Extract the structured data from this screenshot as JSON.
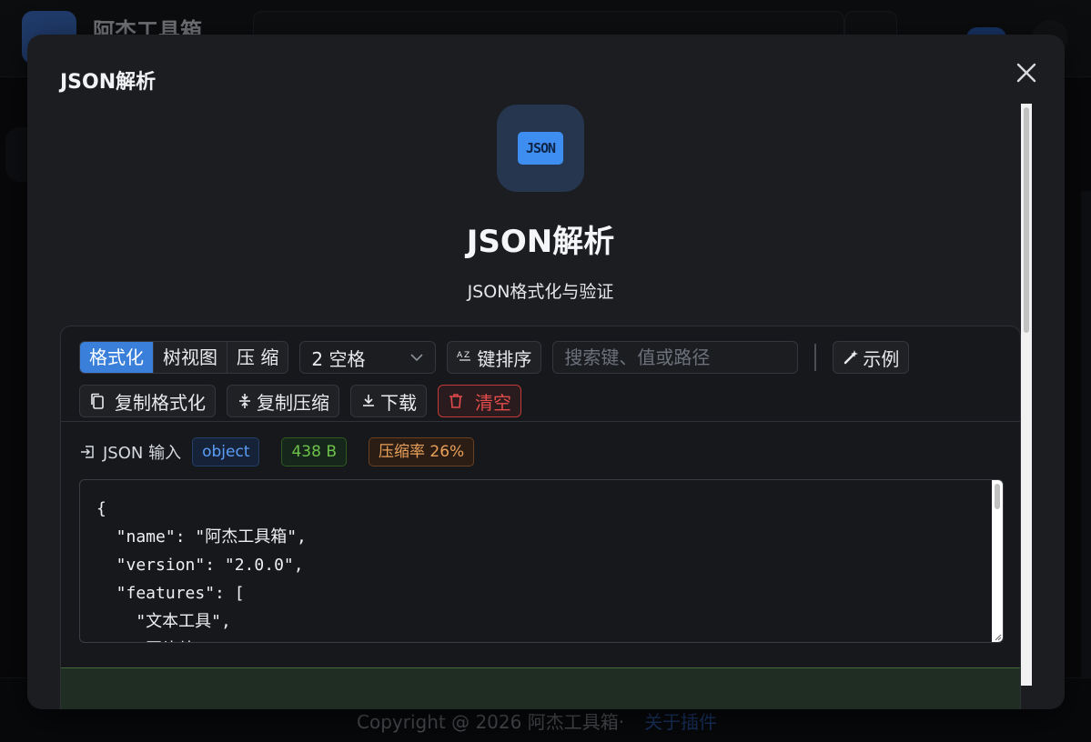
{
  "background": {
    "app_title": "阿杰工具箱",
    "footer_text": "Copyright @ 2026 阿杰工具箱·",
    "footer_link": "关于插件"
  },
  "modal": {
    "title": "JSON解析",
    "close_icon": "close-icon"
  },
  "tool": {
    "icon_text": "JSON",
    "name": "JSON解析",
    "description": "JSON格式化与验证"
  },
  "toolbar": {
    "modes": [
      {
        "label": "格式化",
        "active": true
      },
      {
        "label": "树视图",
        "active": false
      },
      {
        "label": "压 缩",
        "active": false
      }
    ],
    "indent_select": "2 空格",
    "sort_keys": "键排序",
    "search_placeholder": "搜索键、值或路径",
    "example": "示例",
    "copy_formatted": "复制格式化",
    "copy_minified": "复制压缩",
    "download": "下载",
    "clear": "清空"
  },
  "input": {
    "label": "JSON 输入",
    "type_tag": "object",
    "size_tag": "438 B",
    "ratio_tag": "压缩率 26%",
    "content": "{\n  \"name\": \"阿杰工具箱\",\n  \"version\": \"2.0.0\",\n  \"features\": [\n    \"文本工具\",\n    \"图片处"
  },
  "colors": {
    "accent": "#3a7fd9",
    "danger": "#e34b4b",
    "success": "#6cc24a",
    "warning": "#e8a15a"
  }
}
